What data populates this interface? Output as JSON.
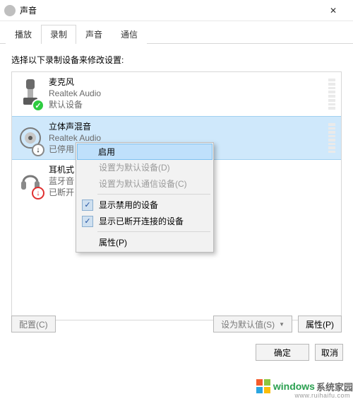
{
  "window": {
    "title": "声音",
    "close_glyph": "✕"
  },
  "tabs": [
    {
      "label": "播放",
      "active": false
    },
    {
      "label": "录制",
      "active": true
    },
    {
      "label": "声音",
      "active": false
    },
    {
      "label": "通信",
      "active": false
    }
  ],
  "instruction": "选择以下录制设备来修改设置:",
  "devices": [
    {
      "name": "麦克风",
      "driver": "Realtek Audio",
      "status": "默认设备",
      "badge": "default",
      "icon": "mic"
    },
    {
      "name": "立体声混音",
      "driver": "Realtek Audio",
      "status": "已停用",
      "badge": "disabled",
      "icon": "stereo",
      "selected": true
    },
    {
      "name": "耳机式",
      "driver": "蓝牙音",
      "status": "已断开",
      "badge": "unplugged",
      "icon": "headset"
    }
  ],
  "context_menu": {
    "enable": "启用",
    "set_default": "设置为默认设备(D)",
    "set_default_comm": "设置为默认通信设备(C)",
    "show_disabled": "显示禁用的设备",
    "show_disconnected": "显示已断开连接的设备",
    "properties": "属性(P)"
  },
  "buttons": {
    "configure": "配置(C)",
    "set_default": "设为默认值(S)",
    "properties": "属性(P)",
    "ok": "确定",
    "cancel": "取消"
  },
  "badge_glyphs": {
    "default": "✓",
    "disabled": "↓",
    "unplugged": "↓"
  },
  "watermark": {
    "brand": "windows",
    "suffix": "系统家园",
    "url": "www.ruihaifu.com"
  }
}
